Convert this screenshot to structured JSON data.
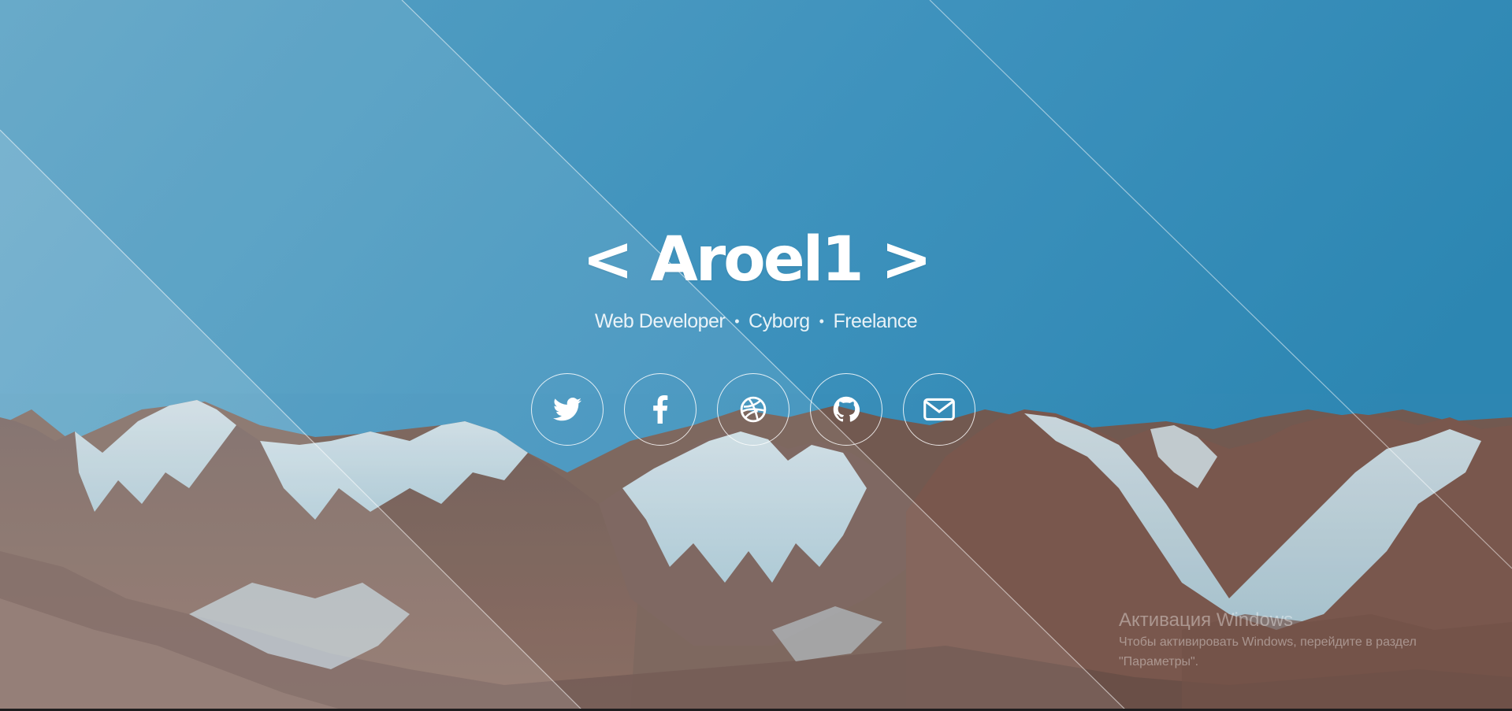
{
  "hero": {
    "title": "< Aroel1 >",
    "tagline": [
      "Web Developer",
      "Cyborg",
      "Freelance"
    ],
    "tagline_separator": "•"
  },
  "socials": [
    {
      "name": "twitter",
      "icon": "twitter-icon"
    },
    {
      "name": "facebook",
      "icon": "facebook-icon"
    },
    {
      "name": "dribbble",
      "icon": "dribbble-icon"
    },
    {
      "name": "github",
      "icon": "github-icon"
    },
    {
      "name": "email",
      "icon": "envelope-icon"
    }
  ],
  "watermark": {
    "title": "Активация Windows",
    "line1": "Чтобы активировать Windows, перейдите в раздел",
    "line2": "\"Параметры\"."
  },
  "colors": {
    "sky": "#2f86b0",
    "sky_light": "#5aa2c4",
    "text": "#ffffff"
  }
}
